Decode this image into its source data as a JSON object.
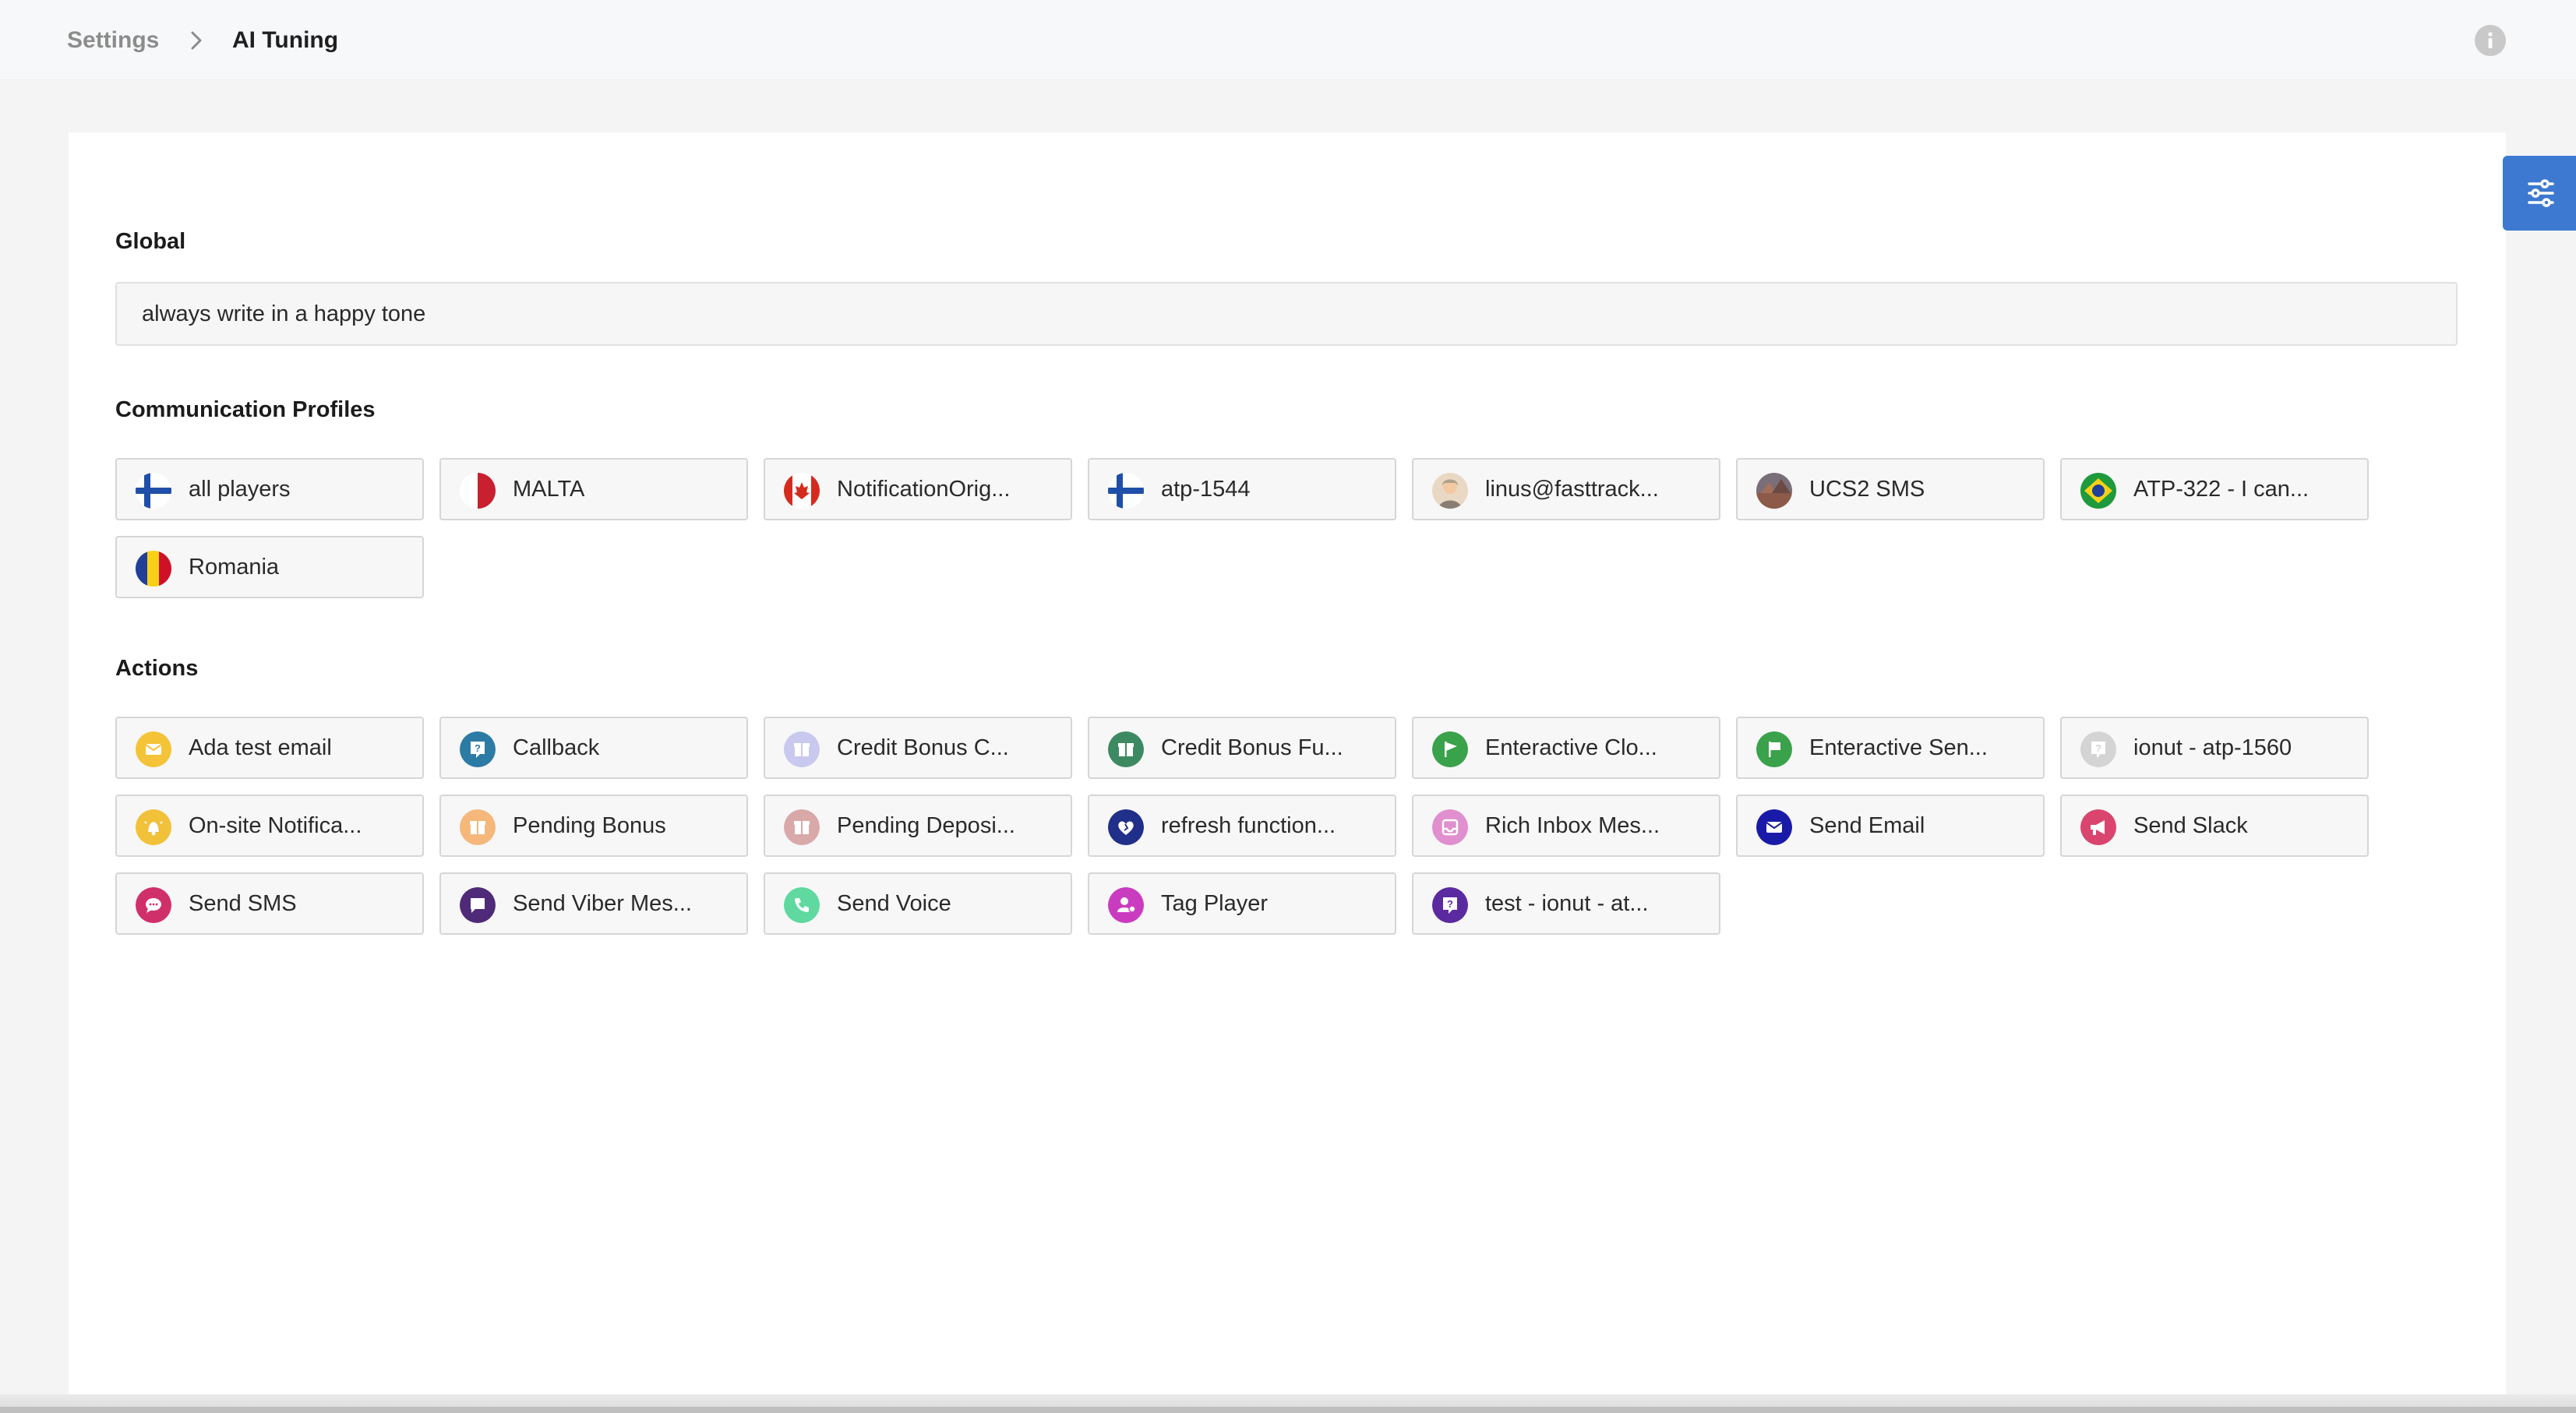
{
  "breadcrumb": {
    "parent": "Settings",
    "current": "AI Tuning"
  },
  "global": {
    "label": "Global",
    "value": "always write in a happy tone"
  },
  "communication_profiles": {
    "label": "Communication Profiles",
    "items": [
      {
        "label": "all players",
        "icon": "finland-flag-icon"
      },
      {
        "label": "MALTA",
        "icon": "malta-flag-icon"
      },
      {
        "label": "NotificationOrig...",
        "icon": "canada-flag-icon"
      },
      {
        "label": "atp-1544",
        "icon": "finland-flag-icon"
      },
      {
        "label": "linus@fasttrack...",
        "icon": "user-avatar-icon"
      },
      {
        "label": "UCS2 SMS",
        "icon": "profile-photo-icon"
      },
      {
        "label": "ATP-322 - I can...",
        "icon": "brazil-flag-icon"
      },
      {
        "label": "Romania",
        "icon": "romania-flag-icon"
      }
    ]
  },
  "actions": {
    "label": "Actions",
    "items": [
      {
        "label": "Ada test email",
        "icon": "envelope-icon",
        "color": "#f4c338"
      },
      {
        "label": "Callback",
        "icon": "question-bubble-icon",
        "color": "#2c7ba5"
      },
      {
        "label": "Credit Bonus C...",
        "icon": "gift-icon",
        "color": "#c9c8ef"
      },
      {
        "label": "Credit Bonus Fu...",
        "icon": "gift-icon",
        "color": "#3d8a62"
      },
      {
        "label": "Enteractive Clo...",
        "icon": "flag-icon",
        "color": "#3aa24a"
      },
      {
        "label": "Enteractive Sen...",
        "icon": "flag-icon",
        "color": "#3aa24a"
      },
      {
        "label": "ionut - atp-1560",
        "icon": "question-bubble-icon",
        "color": "#d4d4d4"
      },
      {
        "label": "On-site Notifica...",
        "icon": "bell-icon",
        "color": "#f2c13a"
      },
      {
        "label": "Pending Bonus",
        "icon": "gift-icon",
        "color": "#f5b87a"
      },
      {
        "label": "Pending Deposi...",
        "icon": "gift-icon",
        "color": "#d9a9a9"
      },
      {
        "label": "refresh function...",
        "icon": "heart-icon",
        "color": "#1f2f8a"
      },
      {
        "label": "Rich Inbox Mes...",
        "icon": "inbox-icon",
        "color": "#e08fcf"
      },
      {
        "label": "Send Email",
        "icon": "envelope-icon",
        "color": "#1a1aa8"
      },
      {
        "label": "Send Slack",
        "icon": "megaphone-icon",
        "color": "#d9456e"
      },
      {
        "label": "Send SMS",
        "icon": "chat-bubble-icon",
        "color": "#d0306a"
      },
      {
        "label": "Send Viber Mes...",
        "icon": "message-icon",
        "color": "#4f2a78"
      },
      {
        "label": "Send Voice",
        "icon": "phone-icon",
        "color": "#5fd9a0"
      },
      {
        "label": "Tag Player",
        "icon": "user-tag-icon",
        "color": "#c93cc0"
      },
      {
        "label": "test - ionut - at...",
        "icon": "question-bubble-icon",
        "color": "#5b2aa0"
      }
    ]
  },
  "colors": {
    "accent": "#3d79d0",
    "background": "#f4f4f4",
    "panel": "#ffffff"
  }
}
